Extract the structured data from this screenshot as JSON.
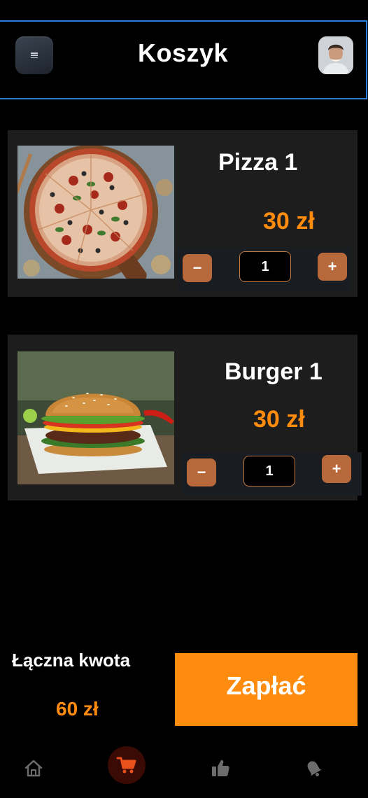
{
  "header": {
    "title": "Koszyk",
    "menu_icon": "menu-icon",
    "avatar": "user-avatar"
  },
  "cart": {
    "items": [
      {
        "name": "Pizza 1",
        "price": "30 zł",
        "quantity": "1",
        "minus": "−",
        "plus": "+",
        "image": "pizza-photo"
      },
      {
        "name": "Burger 1",
        "price": "30 zł",
        "quantity": "1",
        "minus": "−",
        "plus": "+",
        "image": "burger-photo"
      }
    ]
  },
  "summary": {
    "total_label": "Łączna kwota",
    "total_value": "60 zł",
    "pay_label": "Zapłać"
  },
  "nav": {
    "items": [
      {
        "icon": "home-icon",
        "active": false
      },
      {
        "icon": "cart-icon",
        "active": true
      },
      {
        "icon": "thumbs-up-icon",
        "active": false
      },
      {
        "icon": "bell-icon",
        "active": false
      }
    ]
  },
  "colors": {
    "accent": "#ff8c0e",
    "stepper": "#b8693c",
    "card_bg": "#1d1d1d",
    "active_nav": "#e8501c",
    "header_border": "#2a7fd4"
  }
}
